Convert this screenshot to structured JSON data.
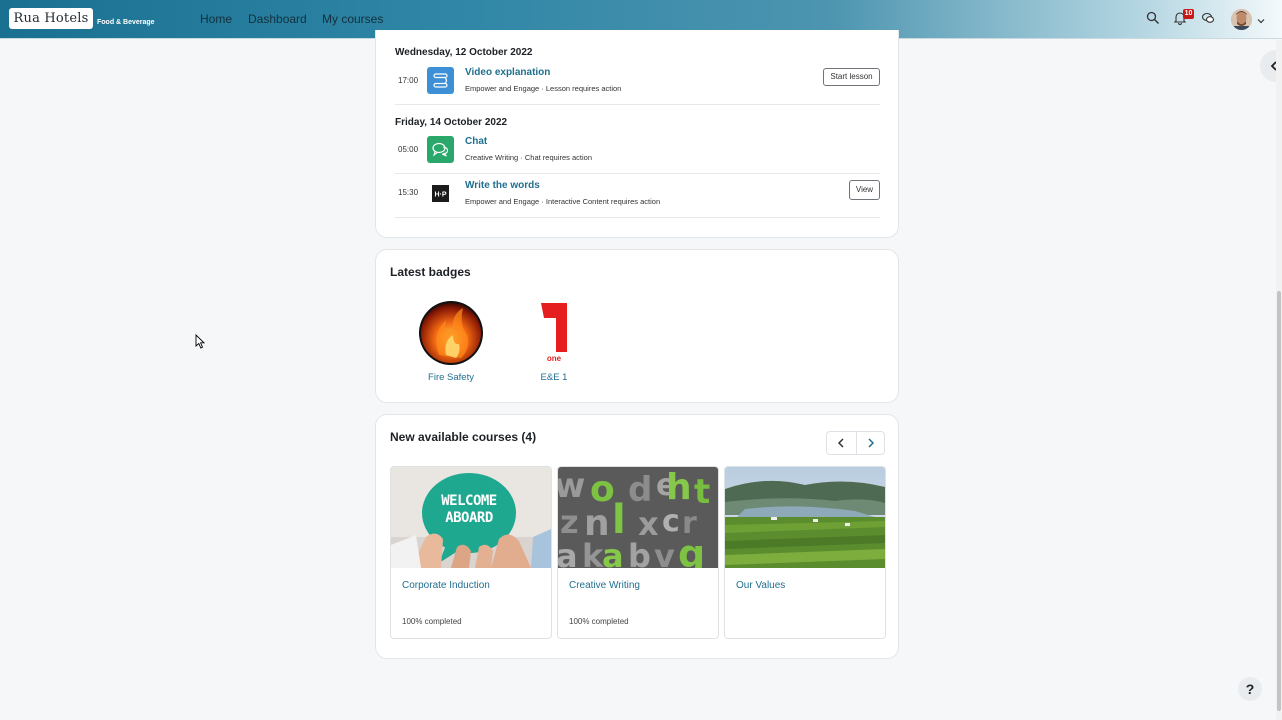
{
  "navbar": {
    "logo_text": "Rua Hotels",
    "logo_sub": "Food & Beverage",
    "links": [
      "Home",
      "Dashboard",
      "My courses"
    ],
    "notification_count": "10"
  },
  "timeline": {
    "groups": [
      {
        "date": "Wednesday, 12 October 2022",
        "events": [
          {
            "time": "17:00",
            "name": "Video explanation",
            "desc": "Empower and Engage · Lesson requires action",
            "action": "Start lesson",
            "icon": "lesson-icon"
          }
        ]
      },
      {
        "date": "Friday, 14 October 2022",
        "events": [
          {
            "time": "05:00",
            "name": "Chat",
            "desc": "Creative Writing · Chat requires action",
            "action": "",
            "icon": "chat-icon"
          },
          {
            "time": "15:30",
            "name": "Write the words",
            "desc": "Empower and Engage · Interactive Content requires action",
            "action": "View",
            "icon": "h5p-icon"
          }
        ]
      }
    ]
  },
  "badges": {
    "title": "Latest badges",
    "items": [
      {
        "name": "Fire Safety"
      },
      {
        "name": "E&E 1",
        "numeral": "1",
        "word": "one"
      }
    ]
  },
  "courses": {
    "title": "New available courses (4)",
    "items": [
      {
        "name": "Corporate Induction",
        "progress": "100% completed",
        "image_text_1": "WELCOME",
        "image_text_2": "ABOARD"
      },
      {
        "name": "Creative Writing",
        "progress": "100% completed"
      },
      {
        "name": "Our Values",
        "progress": ""
      }
    ]
  },
  "help": {
    "label": "?"
  },
  "colors": {
    "accent": "#1f6f8f",
    "lesson_icon": "#3d8fd6",
    "chat_icon": "#2aa86b",
    "badge_red": "#e51f1f"
  }
}
